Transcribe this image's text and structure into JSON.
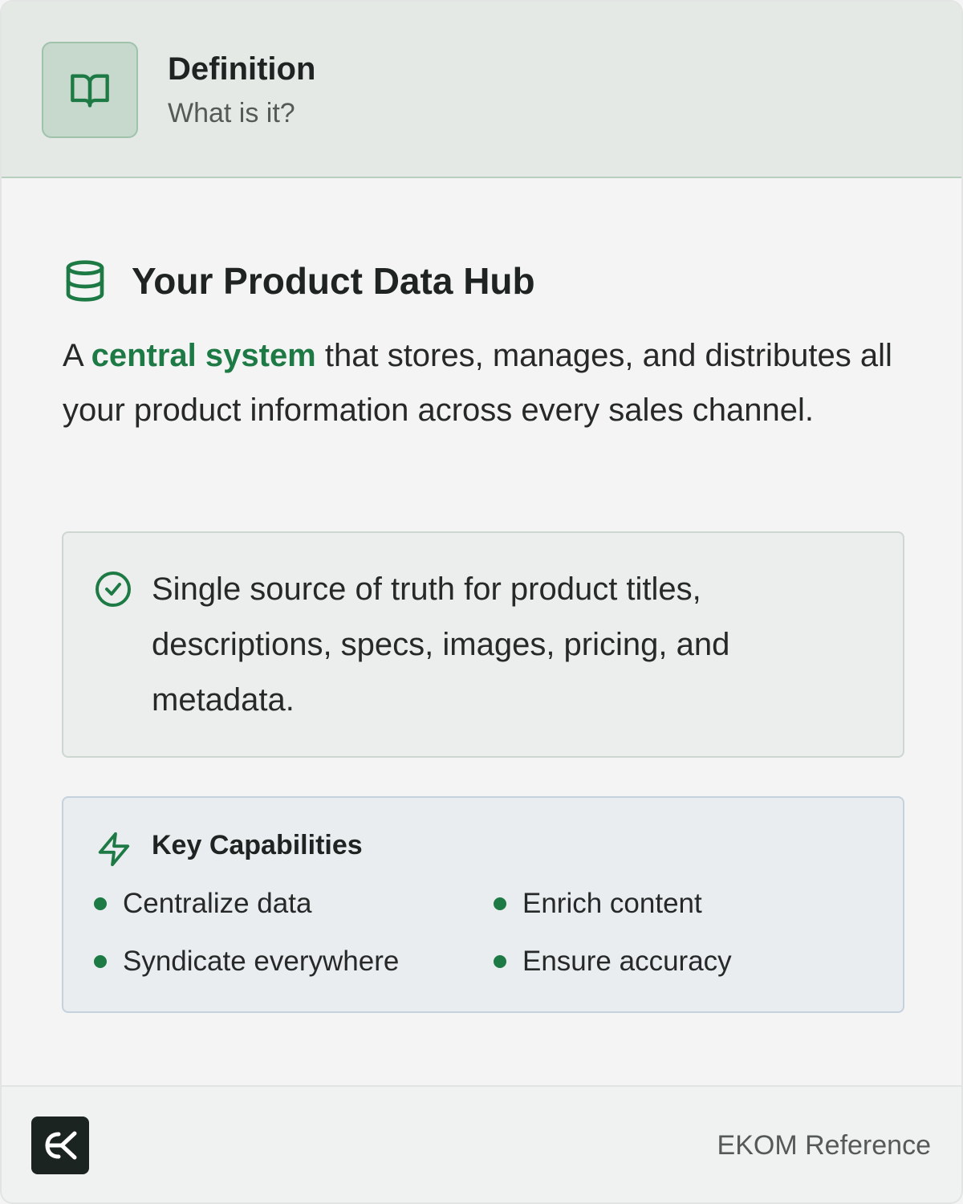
{
  "header": {
    "icon": "book-open-icon",
    "title": "Definition",
    "subtitle": "What is it?"
  },
  "section": {
    "icon": "database-icon",
    "title": "Your Product Data Hub"
  },
  "description": {
    "prefix": "A ",
    "highlight": "central system",
    "suffix": " that stores, manages, and distributes all your product information across every sales channel."
  },
  "truth_box": {
    "icon": "check-circle-icon",
    "text": "Single source of truth for product titles, descriptions, specs, images, pricing, and metadata."
  },
  "capabilities": {
    "icon": "lightning-icon",
    "title": "Key Capabilities",
    "items": [
      "Centralize data",
      "Enrich content",
      "Syndicate everywhere",
      "Ensure accuracy"
    ]
  },
  "footer": {
    "logo": "ekom-logo",
    "text": "EKOM Reference"
  },
  "colors": {
    "accent": "#1e7a45",
    "header_bg": "#e4e9e6",
    "icon_box_bg": "#c6d9cc",
    "capabilities_bg": "#e9edf0",
    "logo_bg": "#1c2422"
  }
}
